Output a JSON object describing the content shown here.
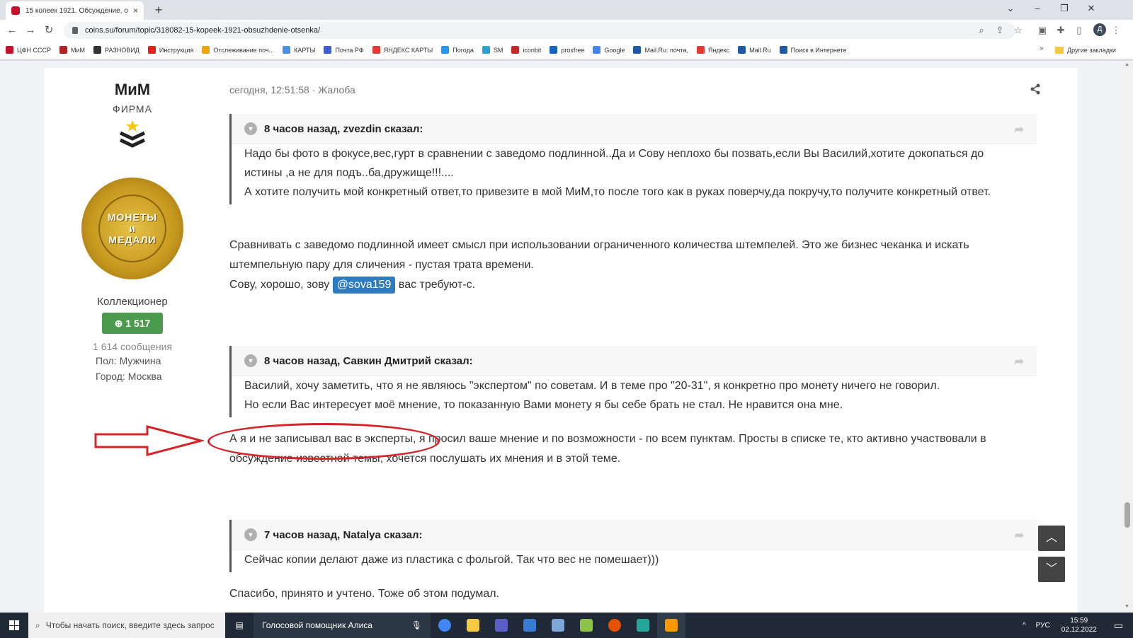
{
  "browser": {
    "tab_title": "15 копеек 1921. Обсуждение, о",
    "tab_close": "×",
    "new_tab": "+",
    "url": "coins.su/forum/topic/318082-15-kopeek-1921-obsuzhdenie-otsenka/",
    "profile_initial": "Д",
    "bookmarks": [
      {
        "label": "ЦФН СССР",
        "color": "#c8102e"
      },
      {
        "label": "МиМ",
        "color": "#b22222"
      },
      {
        "label": "РАЗНОВИД",
        "color": "#333333"
      },
      {
        "label": "Инструкция",
        "color": "#e62117"
      },
      {
        "label": "Отслеживание поч...",
        "color": "#f0a500"
      },
      {
        "label": "КАРТЫ",
        "color": "#4a90e2"
      },
      {
        "label": "Почта РФ",
        "color": "#3b5bdb"
      },
      {
        "label": "ЯНДЕКС КАРТЫ",
        "color": "#e53935"
      },
      {
        "label": "Погода",
        "color": "#2196f3"
      },
      {
        "label": "SM",
        "color": "#29a3d6"
      },
      {
        "label": "iconbit",
        "color": "#c62828"
      },
      {
        "label": "proxfree",
        "color": "#1565c0"
      },
      {
        "label": "Google",
        "color": "#4285f4"
      },
      {
        "label": "Mail.Ru: почта,",
        "color": "#1e5aa8"
      },
      {
        "label": "Яндекс",
        "color": "#e53935"
      },
      {
        "label": "Mail.Ru",
        "color": "#1e5aa8"
      },
      {
        "label": "Поиск в Интернете",
        "color": "#1e5aa8"
      }
    ],
    "bookmarks_more": "»",
    "other_bookmarks": "Другие закладки"
  },
  "author": {
    "name": "МиМ",
    "firm": "ФИРМА",
    "avatar_line1": "МОНЕТЫ",
    "avatar_line2": "и",
    "avatar_line3": "МЕДАЛИ",
    "title": "Коллекционер",
    "reputation": "1 517",
    "messages": "1 614 сообщения",
    "gender_label": "Пол:",
    "gender_value": "Мужчина",
    "city_label": "Город:",
    "city_value": "Москва"
  },
  "post": {
    "meta": "сегодня, 12:51:58 · Жалоба",
    "quotes": [
      {
        "head": "8 часов назад, zvezdin сказал:",
        "body_lines": [
          "Надо бы фото в фокусе,вес,гурт в сравнении с заведомо подлинной..Да и Сову неплохо бы позвать,если Вы Василий,хотите докопаться до истины ,а не для подъ..ба,дружище!!!....",
          "А хотите получить мой конкретный ответ,то привезите в мой МиМ,то после того как в руках поверчу,да покручу,то получите конкретный ответ."
        ]
      },
      {
        "head": "8 часов назад, Савкин Дмитрий сказал:",
        "body_lines": [
          "Василий, хочу заметить, что я не являюсь \"экспертом\" по советам. И в теме про \"20-31\", я конкретно про монету ничего не говорил.",
          "Но если Вас интересует моё мнение, то показанную Вами монету я бы себе брать не стал. Не нравится она мне."
        ]
      },
      {
        "head": "7 часов назад, Natalya сказал:",
        "body_lines": [
          "Сейчас копии делают даже из пластика с фольгой. Так что вес не помешает)))"
        ]
      }
    ],
    "reply1_line1": "Сравнивать с заведомо подлинной имеет смысл при использовании ограниченного количества штемпелей. Это же бизнес чеканка и искать штемпельную пару для сличения - пустая трата времени.",
    "reply1_line2_pre": "Сову, хорошо, зову ",
    "reply1_mention": "@sova159",
    "reply1_line2_post": " вас требуют-с.",
    "reply2": "А я и не записывал вас в эксперты, я просил ваше мнение и по возможности - по всем пунктам. Просты в спиcке те, кто активно участвовали в обсуждение известной темы, хочется послушать их мнения и в этой теме.",
    "reply3": "Спасибо, принято и учтено. Тоже об этом подумал."
  },
  "taskbar": {
    "search_placeholder": "Чтобы начать поиск, введите здесь запрос",
    "alice": "Голосовой помощник Алиса",
    "lang": "РУС",
    "time": "15:59",
    "date": "02.12.2022"
  }
}
